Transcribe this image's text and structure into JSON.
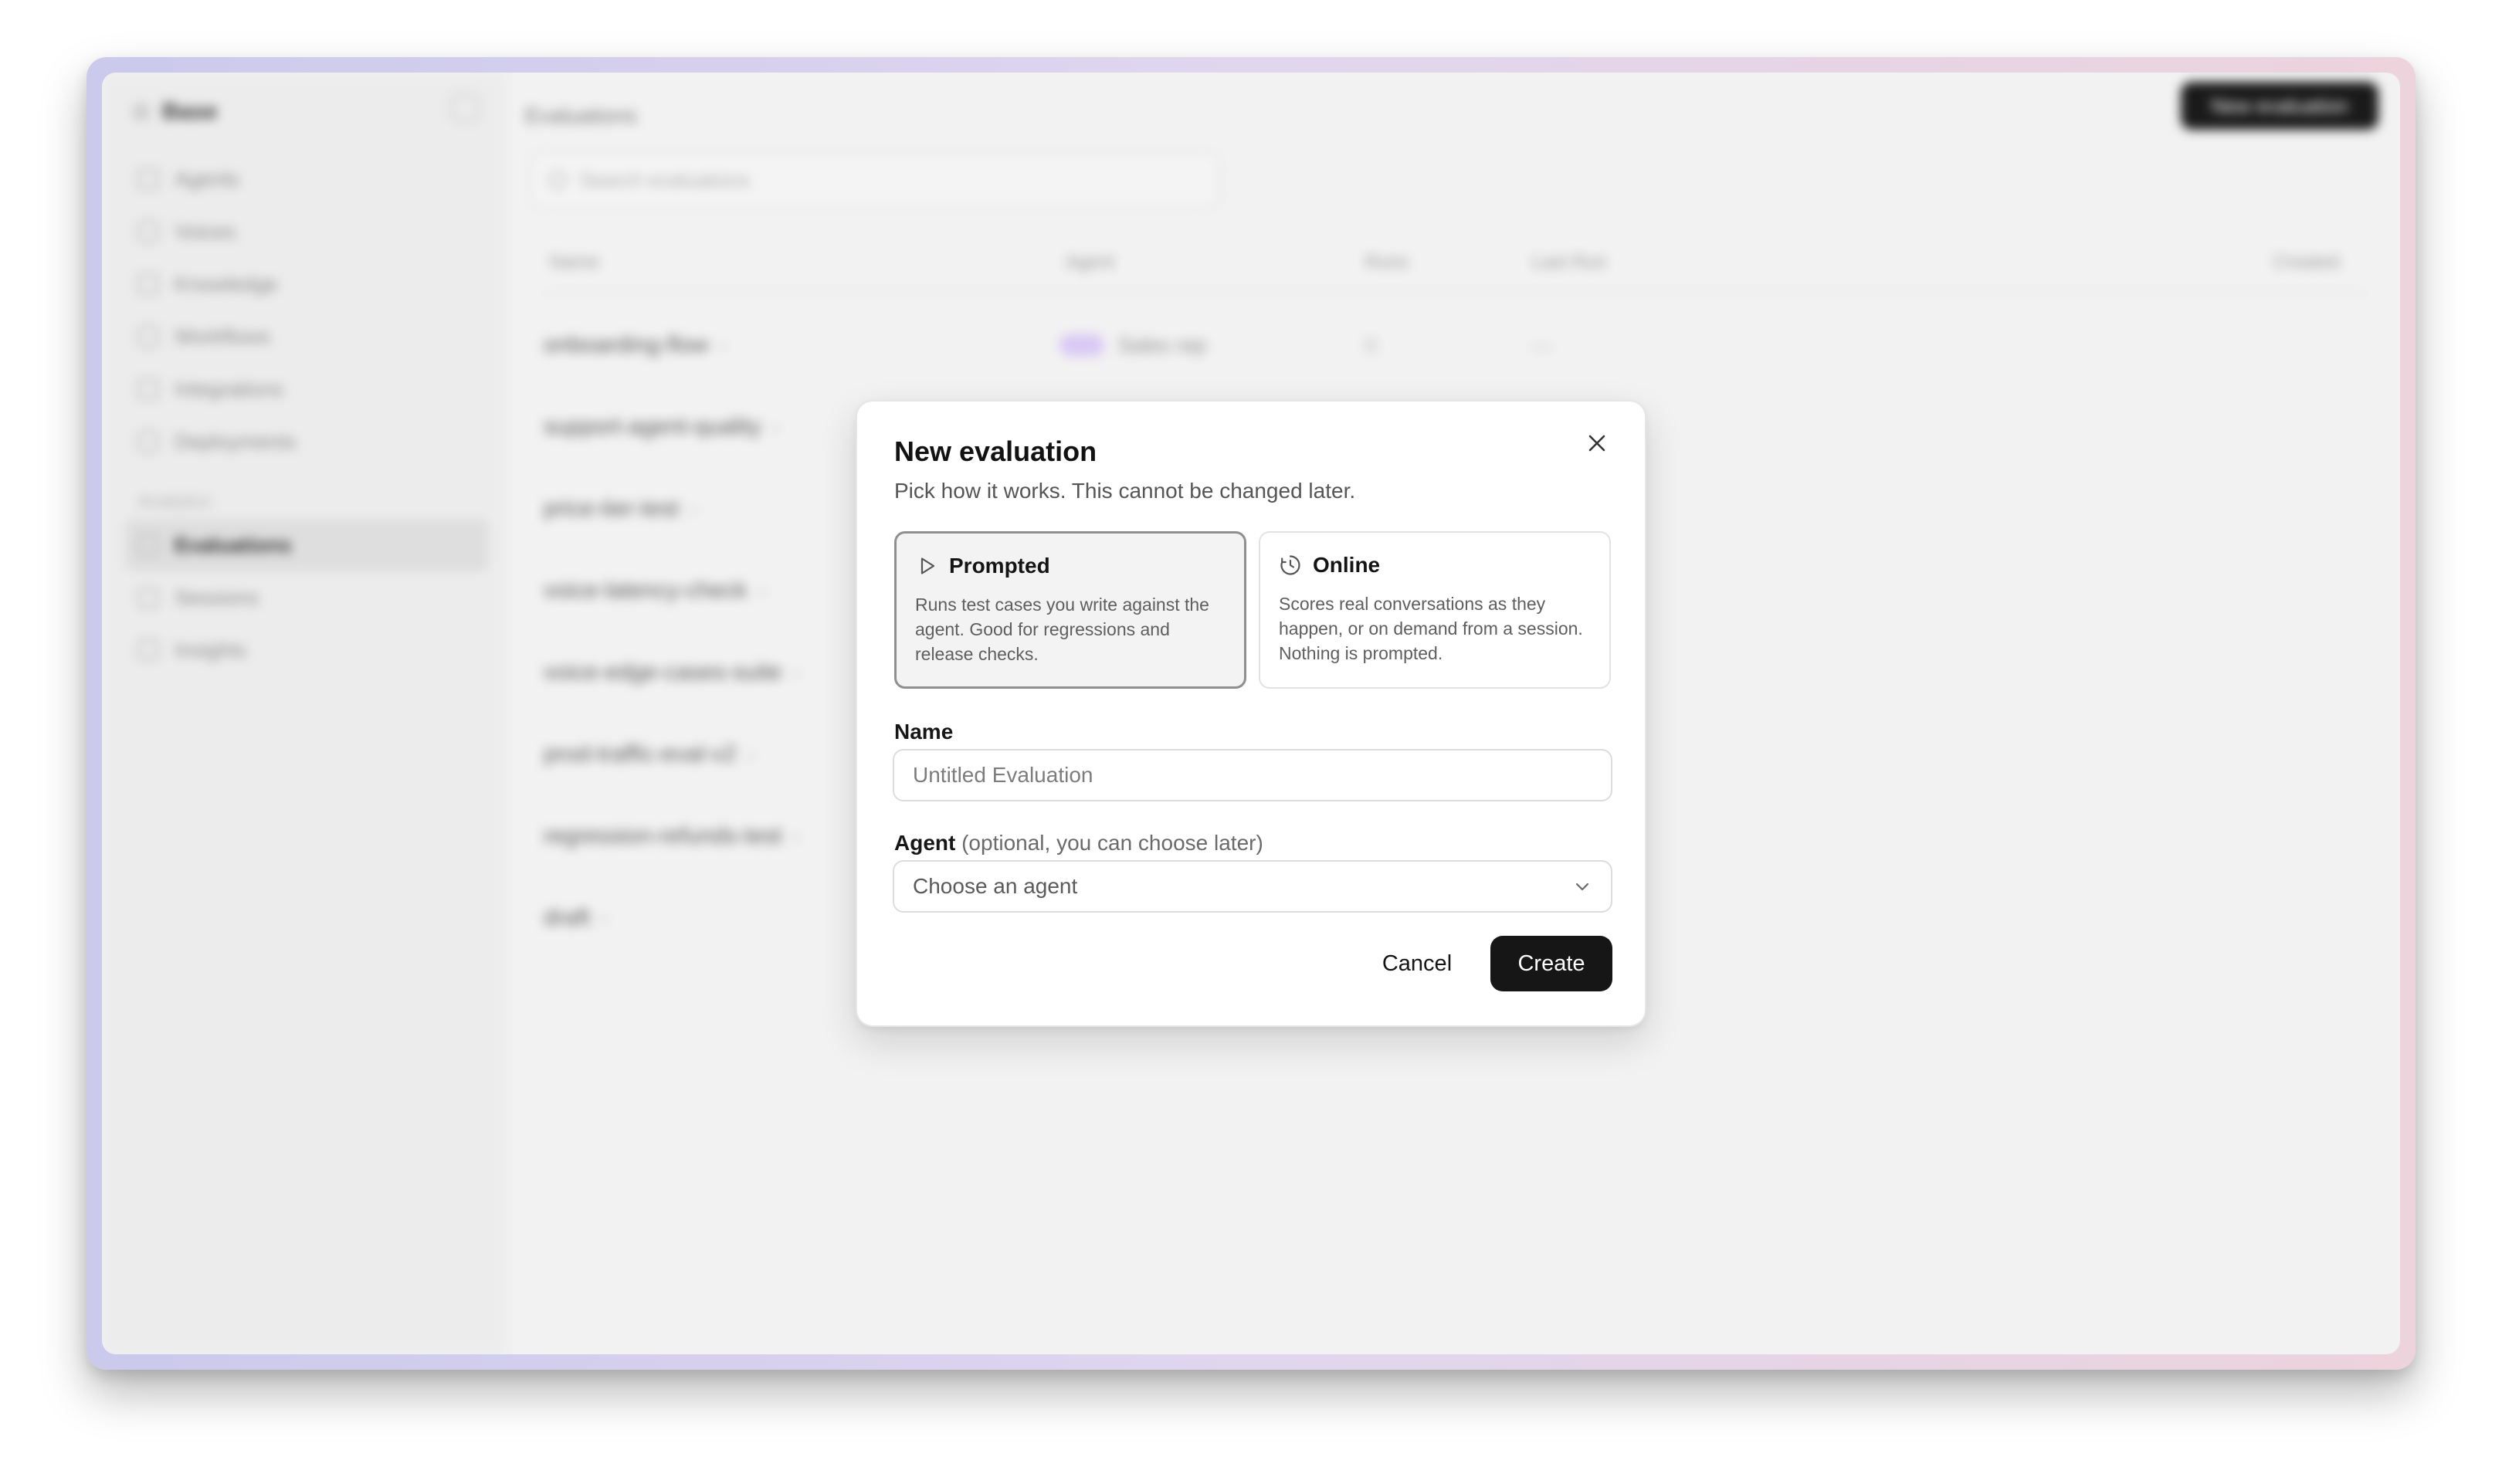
{
  "background": {
    "workspace_name": "Base",
    "sidebar_items": [
      {
        "label": "Agents"
      },
      {
        "label": "Voices"
      },
      {
        "label": "Knowledge"
      },
      {
        "label": "Workflows"
      },
      {
        "label": "Integrations"
      },
      {
        "label": "Deployments"
      }
    ],
    "sidebar_section": "Analytics",
    "sidebar_items_2": [
      {
        "label": "Evaluations",
        "active": true
      },
      {
        "label": "Sessions"
      },
      {
        "label": "Insights"
      }
    ],
    "page_title": "Evaluations",
    "primary_action": "New evaluation",
    "search_placeholder": "Search evaluations",
    "columns": [
      "Name",
      "Agent",
      "Runs",
      "Last Run",
      "Created"
    ],
    "rows": [
      {
        "name": "onboarding-flow",
        "agent": "Sales rep",
        "runs": "0",
        "last_run": "—"
      },
      {
        "name": "support-agent-quality",
        "agent": "",
        "runs": "",
        "last_run": ""
      },
      {
        "name": "price-tier-test",
        "agent": "",
        "runs": "",
        "last_run": ""
      },
      {
        "name": "voice-latency-check",
        "agent": "",
        "runs": "",
        "last_run": ""
      },
      {
        "name": "voice-edge-cases-suite",
        "agent": "",
        "runs": "",
        "last_run": ""
      },
      {
        "name": "prod-traffic-eval-v2",
        "agent": "",
        "runs": "",
        "last_run": ""
      },
      {
        "name": "regression-refunds-test",
        "agent": "",
        "runs": "",
        "last_run": ""
      },
      {
        "name": "draft",
        "agent": "",
        "runs": "",
        "last_run": ""
      }
    ]
  },
  "modal": {
    "title": "New evaluation",
    "subtitle": "Pick how it works. This cannot be changed later.",
    "close_icon": "close-icon",
    "options": [
      {
        "title": "Prompted",
        "icon": "play-icon",
        "description": "Runs test cases you write against the agent. Good for regressions and release checks.",
        "selected": true
      },
      {
        "title": "Online",
        "icon": "live-clock-icon",
        "description": "Scores real conversations as they happen, or on demand from a session. Nothing is prompted.",
        "selected": false
      }
    ],
    "name_label": "Name",
    "name_value": "",
    "name_placeholder": "Untitled Evaluation",
    "agent_label": "Agent",
    "agent_hint": "(optional, you can choose later)",
    "agent_value": "Choose an agent",
    "cancel_label": "Cancel",
    "create_label": "Create"
  },
  "colors": {
    "primary_button": "#161616",
    "selected_option_border": "#8f8f8f",
    "frame_gradient_left": "#cbc9ec",
    "frame_gradient_right": "#ecd3dc"
  }
}
